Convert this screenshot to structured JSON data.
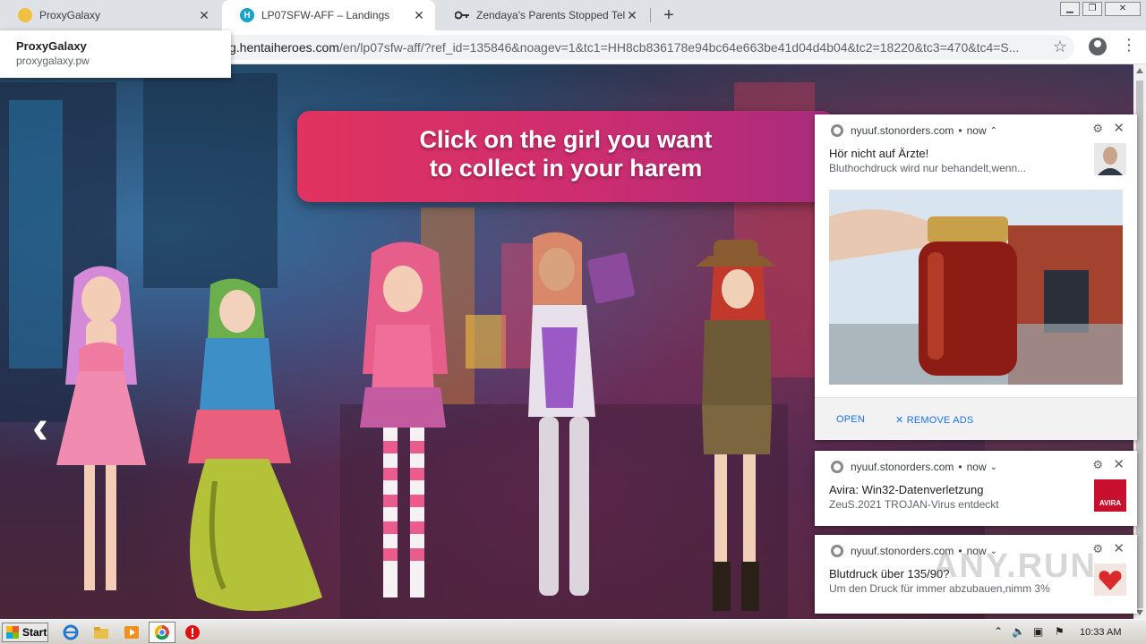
{
  "browser": {
    "tabs": [
      {
        "title": "ProxyGalaxy",
        "icon": "galaxy-icon"
      },
      {
        "title": "LP07SFW-AFF – Landings",
        "icon": "h-logo-icon"
      },
      {
        "title": "Zendaya's Parents Stopped Telling H",
        "icon": "key-icon"
      }
    ],
    "url_domain": "g.hentaiheroes.com",
    "url_path": "/en/lp07sfw-aff/?ref_id=135846&noagev=1&tc1=HH8cb836178e94bc64e663be41d04d4b04&tc2=18220&tc3=470&tc4=S...",
    "hover_card": {
      "title": "ProxyGalaxy",
      "host": "proxygalaxy.pw"
    }
  },
  "page": {
    "banner_line1": "Click on the girl you want",
    "banner_line2": "to collect in your harem",
    "prev_arrow": "‹"
  },
  "notifications": [
    {
      "source": "nyuuf.stonorders.com",
      "time": "now",
      "caret": "⌃",
      "title": "Hör nicht auf Ärzte!",
      "message": "Bluthochdruck wird nur behandelt,wenn...",
      "open_label": "OPEN",
      "remove_label": "REMOVE ADS"
    },
    {
      "source": "nyuuf.stonorders.com",
      "time": "now",
      "caret": "⌄",
      "title": "Avira: Win32-Datenverletzung",
      "message": "ZeuS.2021 TROJAN-Virus entdeckt",
      "thumb_text": "AVIRA"
    },
    {
      "source": "nyuuf.stonorders.com",
      "time": "now",
      "caret": "⌄",
      "title": "Blutdruck über 135/90?",
      "message": "Um den Druck für immer abzubauen,nimm 3%"
    }
  ],
  "watermark": "ANY.RUN",
  "taskbar": {
    "start_label": "Start",
    "clock": "10:33 AM"
  },
  "colors": {
    "banner": "#e0335f",
    "link": "#1a73e8",
    "tab_active": "#ffffff",
    "tab_bar": "#dee1e6"
  }
}
